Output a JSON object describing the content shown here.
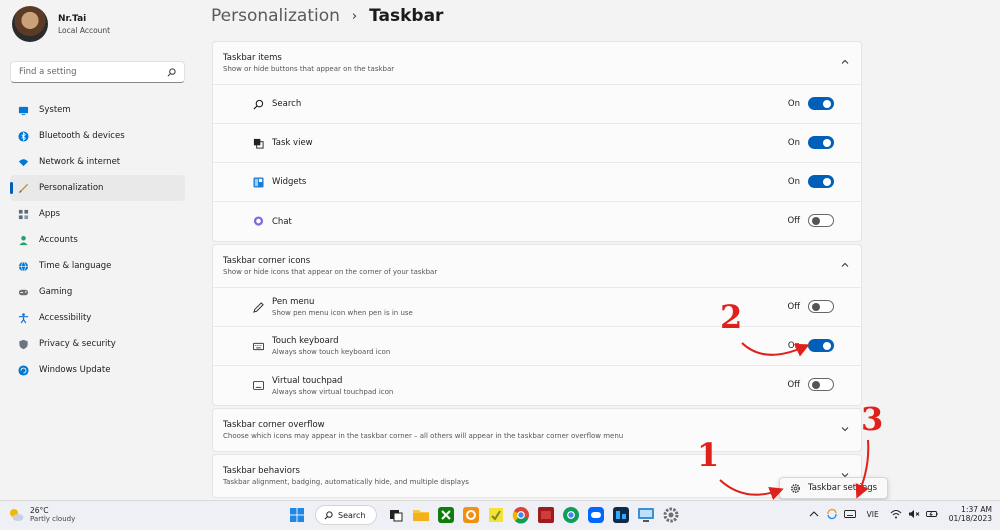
{
  "profile": {
    "name": "Nr.Tai",
    "account_type": "Local Account"
  },
  "search": {
    "placeholder": "Find a setting"
  },
  "nav": {
    "items": [
      {
        "label": "System",
        "icon": "monitor-icon",
        "color": "#0078d4"
      },
      {
        "label": "Bluetooth & devices",
        "icon": "bluetooth-icon",
        "color": "#0078d4"
      },
      {
        "label": "Network & internet",
        "icon": "wifi-icon",
        "color": "#0078d4"
      },
      {
        "label": "Personalization",
        "icon": "brush-icon",
        "color": "#d08a2d",
        "active": true
      },
      {
        "label": "Apps",
        "icon": "apps-icon",
        "color": "#5a6b7a"
      },
      {
        "label": "Accounts",
        "icon": "person-icon",
        "color": "#2aa36b"
      },
      {
        "label": "Time & language",
        "icon": "globe-icon",
        "color": "#0078d4"
      },
      {
        "label": "Gaming",
        "icon": "gamepad-icon",
        "color": "#6d6d6d"
      },
      {
        "label": "Accessibility",
        "icon": "accessibility-icon",
        "color": "#1f6fd0"
      },
      {
        "label": "Privacy & security",
        "icon": "shield-icon",
        "color": "#6d7480"
      },
      {
        "label": "Windows Update",
        "icon": "update-icon",
        "color": "#0078d4"
      }
    ]
  },
  "header": {
    "parent": "Personalization",
    "separator": "›",
    "current": "Taskbar"
  },
  "sections": {
    "taskbar_items": {
      "title": "Taskbar items",
      "subtitle": "Show or hide buttons that appear on the taskbar",
      "rows": [
        {
          "label": "Search",
          "state": "On",
          "icon": "search-icon"
        },
        {
          "label": "Task view",
          "state": "On",
          "icon": "task-view-icon"
        },
        {
          "label": "Widgets",
          "state": "On",
          "icon": "widgets-icon"
        },
        {
          "label": "Chat",
          "state": "Off",
          "icon": "chat-icon"
        }
      ]
    },
    "corner_icons": {
      "title": "Taskbar corner icons",
      "subtitle": "Show or hide icons that appear on the corner of your taskbar",
      "rows": [
        {
          "label": "Pen menu",
          "sub": "Show pen menu icon when pen is in use",
          "state": "Off",
          "icon": "pen-icon"
        },
        {
          "label": "Touch keyboard",
          "sub": "Always show touch keyboard icon",
          "state": "On",
          "icon": "keyboard-icon"
        },
        {
          "label": "Virtual touchpad",
          "sub": "Always show virtual touchpad icon",
          "state": "Off",
          "icon": "touchpad-icon"
        }
      ]
    },
    "corner_overflow": {
      "title": "Taskbar corner overflow",
      "subtitle": "Choose which icons may appear in the taskbar corner – all others will appear in the taskbar corner overflow menu"
    },
    "behaviors": {
      "title": "Taskbar behaviors",
      "subtitle": "Taskbar alignment, badging, automatically hide, and multiple displays"
    }
  },
  "tooltip": {
    "label": "Taskbar settings",
    "icon": "gear-icon"
  },
  "taskbar": {
    "weather": {
      "temp": "26°C",
      "condition": "Partly cloudy"
    },
    "search_label": "Search",
    "language": "VIE",
    "time": "1:37 AM",
    "date": "01/18/2023"
  },
  "annotations": {
    "n1": "1",
    "n2": "2",
    "n3": "3"
  },
  "colors": {
    "accent": "#005fb8",
    "annotation": "#e0201a"
  }
}
